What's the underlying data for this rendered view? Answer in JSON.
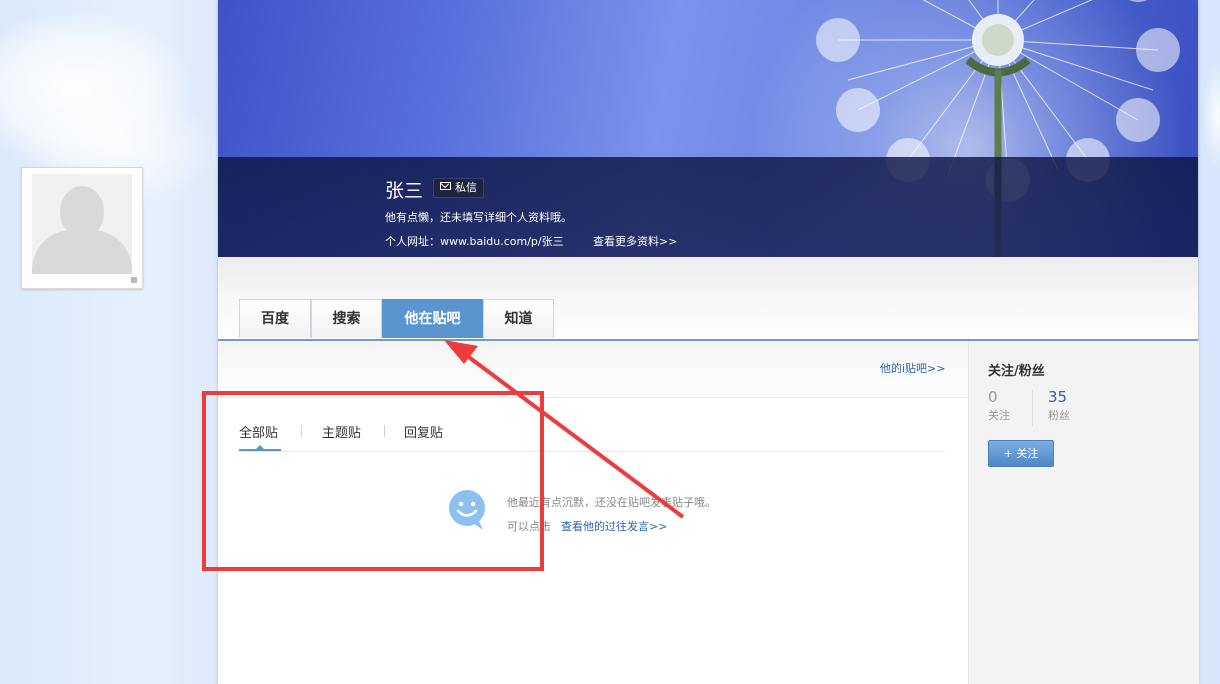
{
  "profile": {
    "username": "张三",
    "pm_label": "私信",
    "bio": "他有点懒，还未填写详细个人资料哦。",
    "url_label": "个人网址：www.baidu.com/p/张三",
    "more_link": "查看更多资料>>"
  },
  "tabs": [
    {
      "label": "百度",
      "active": false
    },
    {
      "label": "搜索",
      "active": false
    },
    {
      "label": "他在贴吧",
      "active": true
    },
    {
      "label": "知道",
      "active": false
    }
  ],
  "feed": {
    "ibar_link": "他的i贴吧>>",
    "subtabs": [
      "全部贴",
      "主题贴",
      "回复贴"
    ],
    "empty_message": "他最近有点沉默，还没在贴吧发表贴子哦。",
    "empty_prefix": "可以点击",
    "empty_link": "查看他的过往发言>>",
    "empty_icon": "smile-chat-icon"
  },
  "sidebar": {
    "title": "关注/粉丝",
    "following_count": "0",
    "following_label": "关注",
    "fans_count": "35",
    "fans_label": "粉丝",
    "follow_button": "+ 关注"
  },
  "colors": {
    "accent": "#5b95cf",
    "link": "#2d64b3",
    "annotation": "#ee3b3b"
  }
}
